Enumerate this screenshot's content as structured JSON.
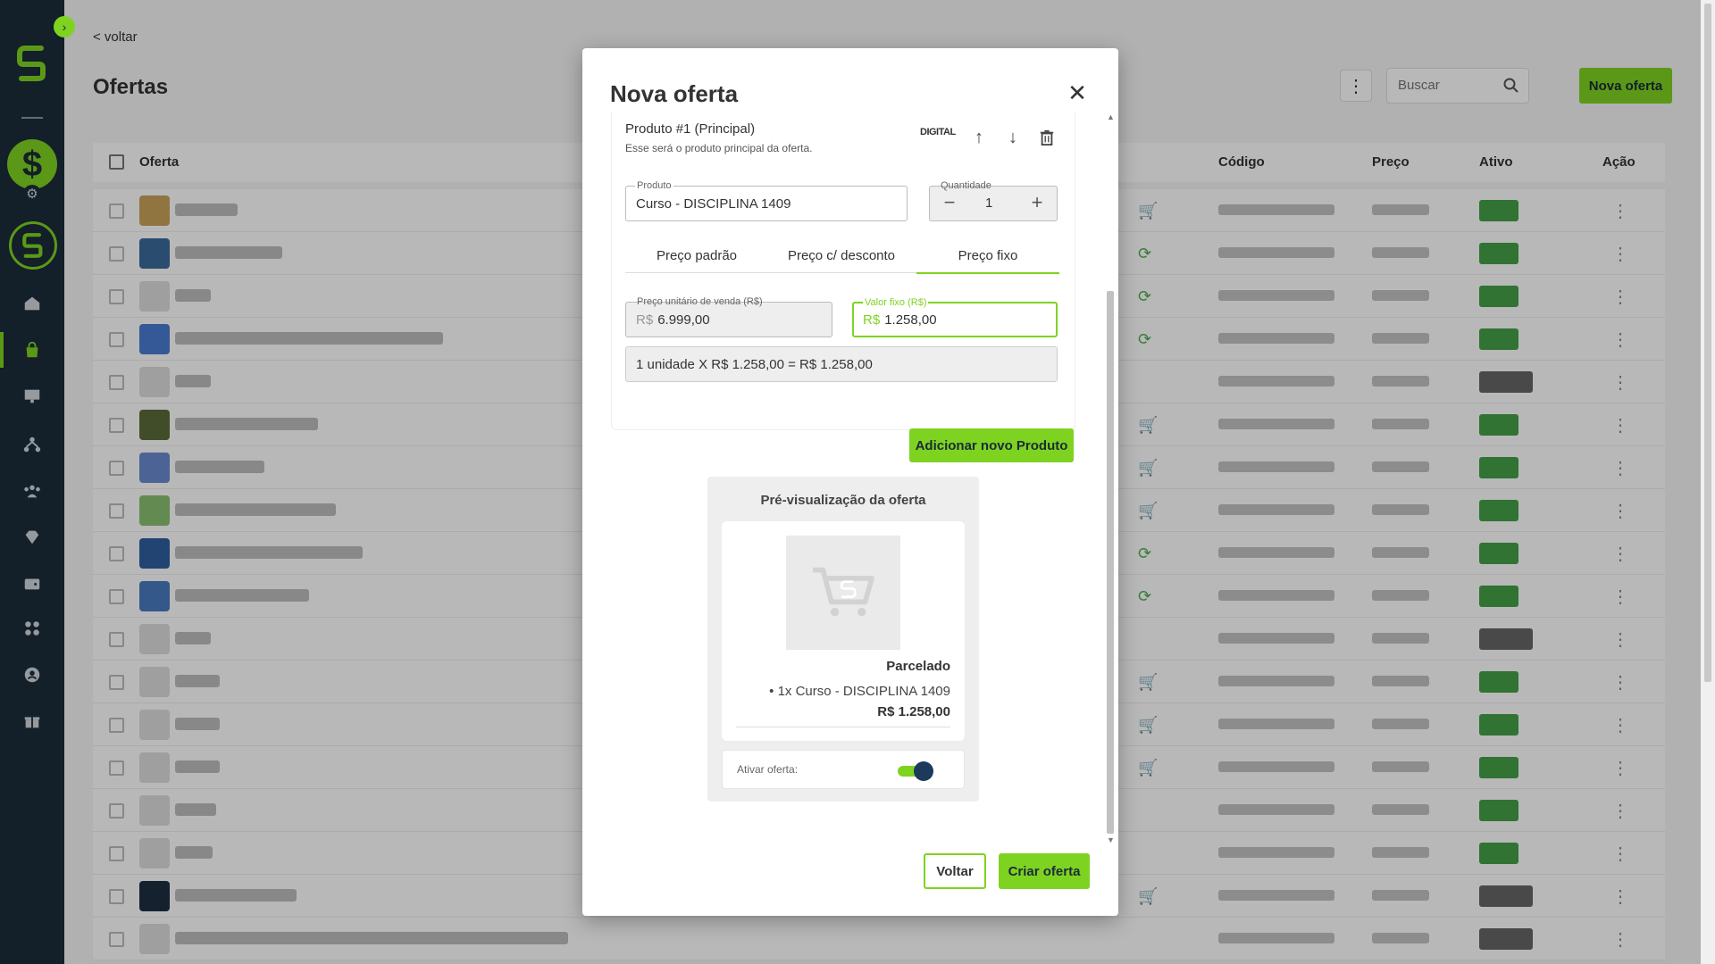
{
  "page": {
    "back_label": "< voltar",
    "title": "Ofertas",
    "search_placeholder": "Buscar",
    "new_offer_label": "Nova oferta"
  },
  "table": {
    "columns": [
      "Oferta",
      "Código",
      "Preço",
      "Ativo",
      "Ação"
    ]
  },
  "modal": {
    "title": "Nova oferta",
    "product": {
      "title": "Produto #1 (Principal)",
      "subtitle": "Esse será o produto principal da oferta.",
      "tag": "DIGITAL",
      "product_label": "Produto",
      "product_value": "Curso - DISCIPLINA 1409",
      "qty_label": "Quantidade",
      "qty_value": "1"
    },
    "tabs": [
      "Preço padrão",
      "Preço c/ desconto",
      "Preço fixo"
    ],
    "active_tab": "Preço fixo",
    "unit_price": {
      "label": "Preço unitário de venda (R$)",
      "prefix": "R$",
      "value": "6.999,00"
    },
    "fixed_price": {
      "label": "Valor fixo (R$)",
      "prefix": "R$",
      "value": "1.258,00"
    },
    "summary": "1 unidade X R$ 1.258,00 = R$ 1.258,00",
    "add_product_label": "Adicionar novo Produto",
    "preview": {
      "title": "Pré-visualização da oferta",
      "name": "Parcelado",
      "item": "• 1x Curso - DISCIPLINA 1409",
      "price": "R$ 1.258,00",
      "activate_label": "Ativar oferta:",
      "activate_on": true
    },
    "back_label": "Voltar",
    "create_label": "Criar oferta"
  },
  "colors": {
    "accent": "#7ed321",
    "sidebar": "#1b2b3a"
  }
}
